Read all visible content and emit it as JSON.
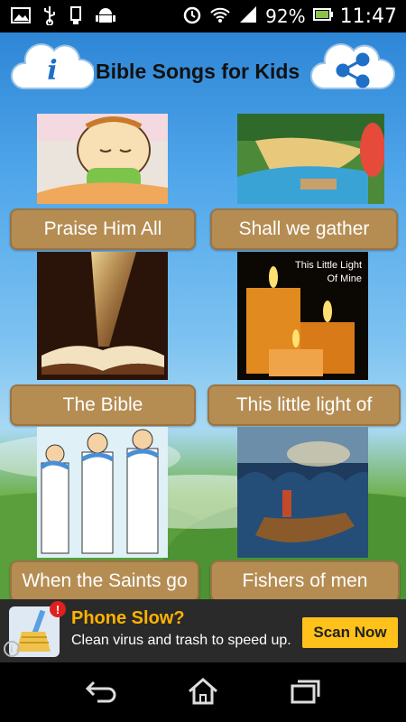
{
  "status_bar": {
    "battery": "92%",
    "time": "11:47"
  },
  "header": {
    "title": "Bible Songs for Kids",
    "info_icon": "info-icon",
    "share_icon": "share-icon"
  },
  "songs": [
    {
      "label": "Praise Him All"
    },
    {
      "label": "Shall we gather"
    },
    {
      "label": "The Bible"
    },
    {
      "label": "This little light of"
    },
    {
      "label": "When the Saints go"
    },
    {
      "label": "Fishers of men"
    }
  ],
  "thumb_text": {
    "candle_caption_line1": "This Little Light",
    "candle_caption_line2": "Of Mine"
  },
  "ad": {
    "title": "Phone Slow?",
    "subtitle": "Clean virus and trash to speed up.",
    "button": "Scan Now",
    "badge": "!",
    "info": "i"
  },
  "colors": {
    "button_bg": "#b58d53",
    "ad_title": "#ffb300",
    "ad_button": "#ffc21a"
  }
}
